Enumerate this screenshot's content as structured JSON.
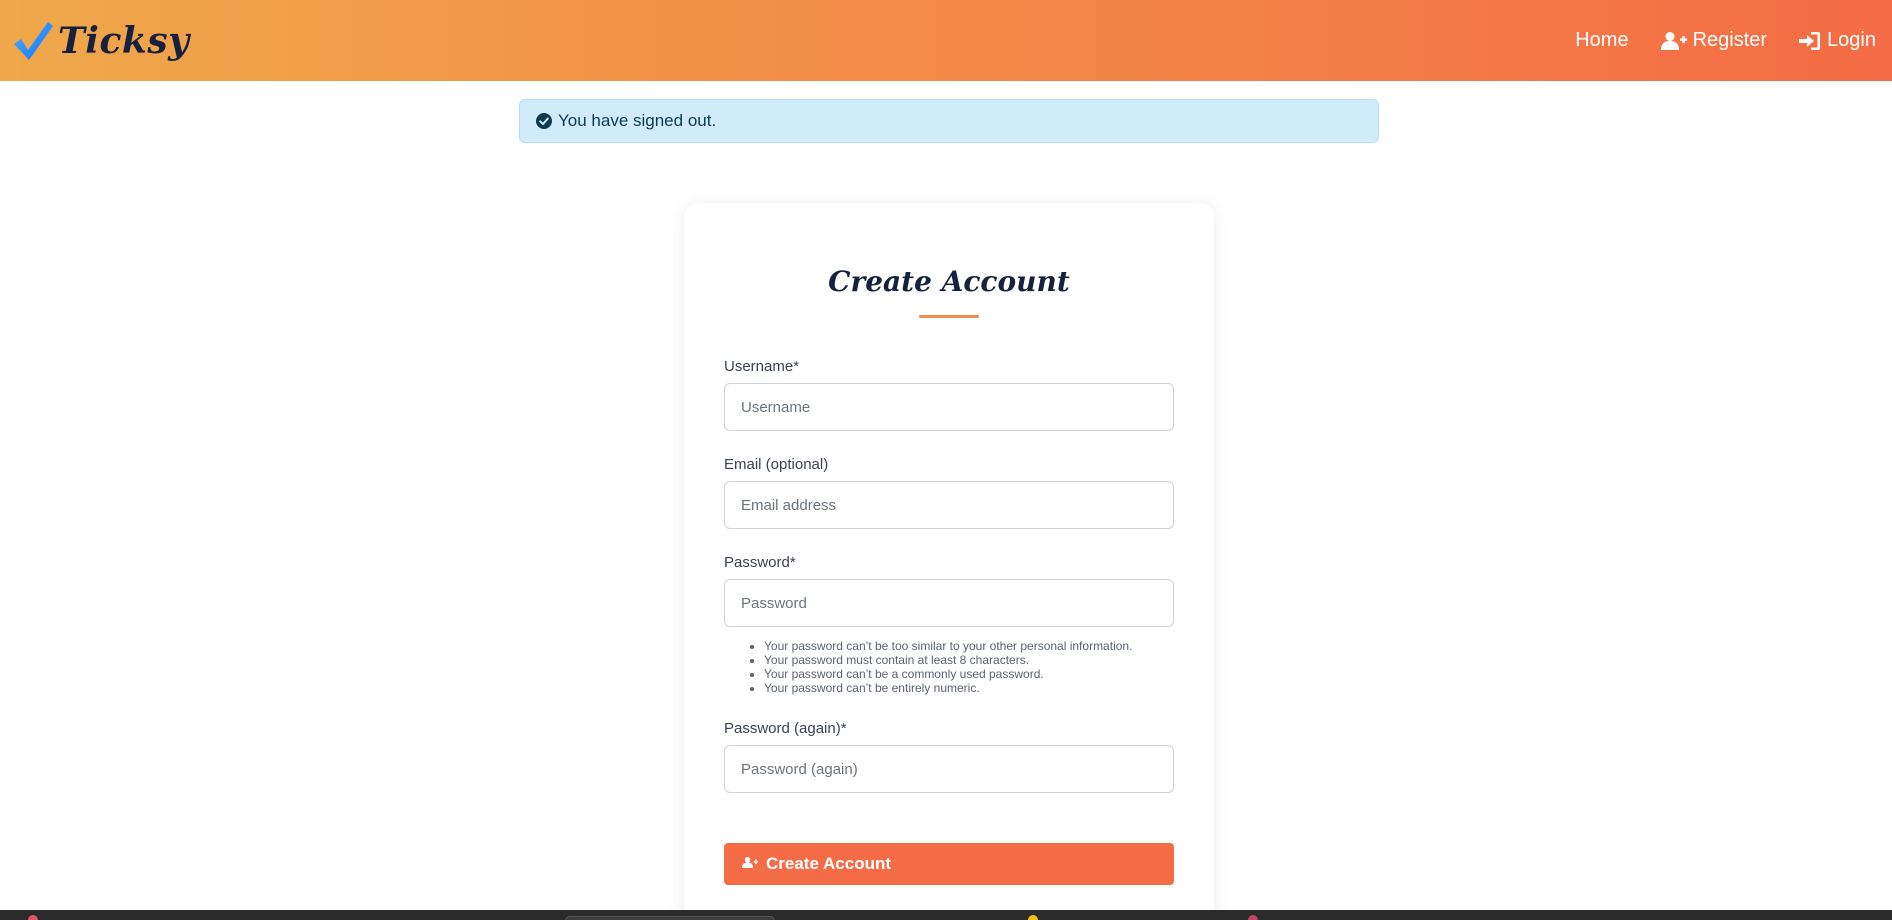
{
  "brand": {
    "name": "Ticksy",
    "icon": "checkmark-icon"
  },
  "nav": {
    "home": "Home",
    "register": "Register",
    "login": "Login"
  },
  "alert": {
    "message": "You have signed out.",
    "icon": "check-circle-icon"
  },
  "form": {
    "title": "Create Account",
    "username_label": "Username*",
    "username_placeholder": "Username",
    "email_label": "Email (optional)",
    "email_placeholder": "Email address",
    "password_label": "Password*",
    "password_placeholder": "Password",
    "password_help": [
      "Your password can’t be too similar to your other personal information.",
      "Your password must contain at least 8 characters.",
      "Your password can’t be a commonly used password.",
      "Your password can’t be entirely numeric."
    ],
    "password2_label": "Password (again)*",
    "password2_placeholder": "Password (again)",
    "submit_label": "Create Account"
  },
  "colors": {
    "nav_gradient_start": "#f0a84a",
    "nav_gradient_end": "#f46c45",
    "accent": "#f46c45",
    "alert_bg": "#d1ebfb",
    "brand_text": "#16213e"
  }
}
